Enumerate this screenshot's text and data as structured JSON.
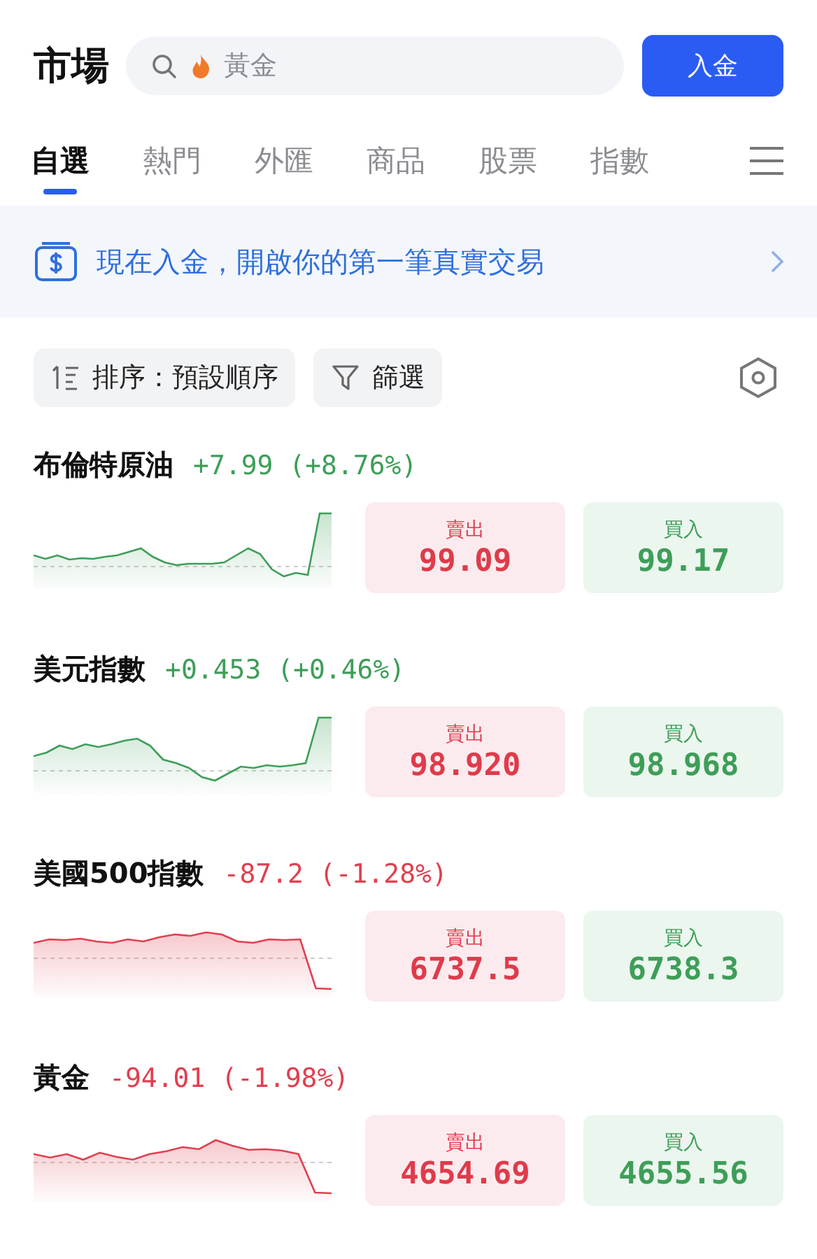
{
  "header": {
    "title": "市場",
    "search": {
      "placeholder": "黃金"
    },
    "deposit_button": "入金"
  },
  "tabs": [
    {
      "label": "自選",
      "selected": true
    },
    {
      "label": "熱門",
      "selected": false
    },
    {
      "label": "外匯",
      "selected": false
    },
    {
      "label": "商品",
      "selected": false
    },
    {
      "label": "股票",
      "selected": false
    },
    {
      "label": "指數",
      "selected": false
    }
  ],
  "banner": {
    "text": "現在入金，開啟你的第一筆真實交易"
  },
  "filters": {
    "sort": "排序：預設順序",
    "filter": "篩選"
  },
  "quotes": [
    {
      "name": "布倫特原油",
      "change": "+7.99 (+8.76%)",
      "rising": true,
      "sell_label": "賣出",
      "sell": "99.09",
      "buy_label": "買入",
      "buy": "99.17"
    },
    {
      "name": "美元指數",
      "change": "+0.453 (+0.46%)",
      "rising": true,
      "sell_label": "賣出",
      "sell": "98.920",
      "buy_label": "買入",
      "buy": "98.968"
    },
    {
      "name": "美國500指數",
      "change": "-87.2 (-1.28%)",
      "rising": false,
      "sell_label": "賣出",
      "sell": "6737.5",
      "buy_label": "買入",
      "buy": "6738.3"
    },
    {
      "name": "黃金",
      "change": "-94.01 (-1.98%)",
      "rising": false,
      "sell_label": "賣出",
      "sell": "4654.69",
      "buy_label": "買入",
      "buy": "4655.56"
    }
  ]
}
